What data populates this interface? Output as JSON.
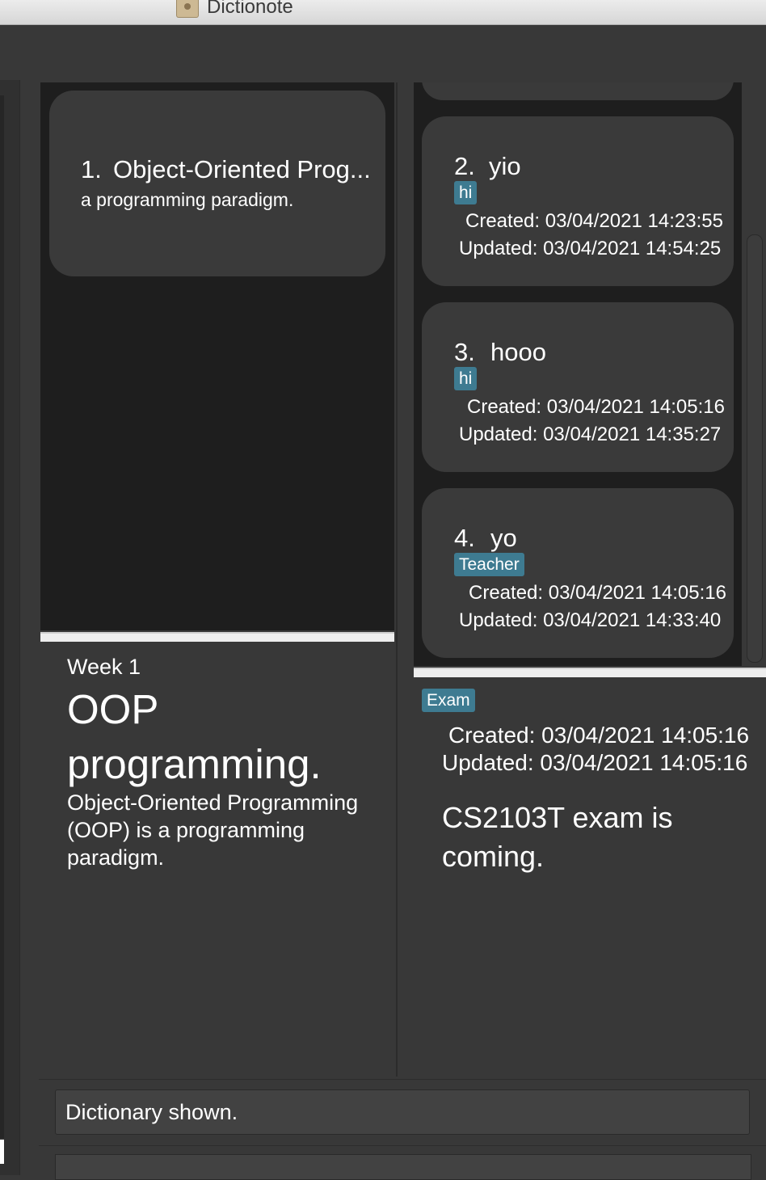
{
  "window": {
    "title": "Dictionote"
  },
  "dictionary": {
    "items": [
      {
        "index": "1.",
        "title": "Object-Oriented Prog...",
        "summary": "a programming paradigm."
      }
    ],
    "content": {
      "week": "Week 1",
      "title": "OOP programming.",
      "description": "Object-Oriented Programming (OOP) is a programming paradigm."
    }
  },
  "notes": {
    "items": [
      {
        "index": "2.",
        "title": "yio",
        "tag": "hi",
        "created": "Created: 03/04/2021 14:23:55",
        "updated": "Updated: 03/04/2021 14:54:25"
      },
      {
        "index": "3.",
        "title": "hooo",
        "tag": "hi",
        "created": "Created: 03/04/2021 14:05:16",
        "updated": "Updated: 03/04/2021 14:35:27"
      },
      {
        "index": "4.",
        "title": "yo",
        "tag": "Teacher",
        "created": "Created: 03/04/2021 14:05:16",
        "updated": "Updated: 03/04/2021 14:33:40"
      }
    ],
    "content": {
      "tag": "Exam",
      "created": "Created: 03/04/2021 14:05:16",
      "updated": "Updated: 03/04/2021 14:05:16",
      "text": "CS2103T exam is coming."
    }
  },
  "status": {
    "message": "Dictionary shown."
  },
  "command": {
    "value": ""
  }
}
